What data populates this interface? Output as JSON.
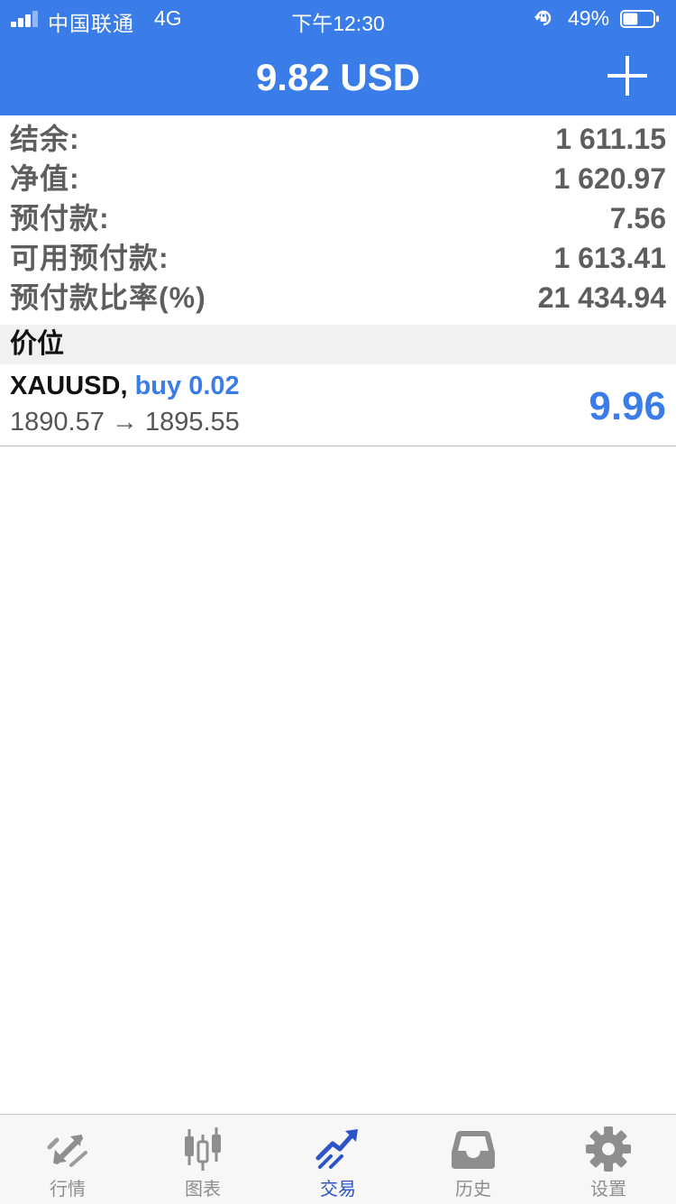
{
  "status_bar": {
    "carrier": "中国联通",
    "network": "4G",
    "time": "下午12:30",
    "battery_percent": "49%",
    "battery_level": 0.49
  },
  "header": {
    "title": "9.82 USD",
    "add_icon": "plus-icon"
  },
  "summary": [
    {
      "label": "结余:",
      "value": "1 611.15"
    },
    {
      "label": "净值:",
      "value": "1 620.97"
    },
    {
      "label": "预付款:",
      "value": "7.56"
    },
    {
      "label": "可用预付款:",
      "value": "1 613.41"
    },
    {
      "label": "预付款比率(%)",
      "value": "21 434.94"
    }
  ],
  "positions": {
    "header": "价位",
    "items": [
      {
        "symbol": "XAUUSD,",
        "side": "buy 0.02",
        "open_price": "1890.57",
        "arrow": "→",
        "current_price": "1895.55",
        "profit": "9.96"
      }
    ]
  },
  "tabbar": {
    "active": "trade",
    "tabs": [
      {
        "id": "quotes",
        "label": "行情",
        "icon": "quotes-arrows-icon"
      },
      {
        "id": "charts",
        "label": "图表",
        "icon": "candlestick-icon"
      },
      {
        "id": "trade",
        "label": "交易",
        "icon": "trade-trend-icon"
      },
      {
        "id": "history",
        "label": "历史",
        "icon": "inbox-tray-icon"
      },
      {
        "id": "settings",
        "label": "设置",
        "icon": "gear-icon"
      }
    ]
  },
  "colors": {
    "header_bg": "#3a7de9",
    "accent_blue": "#3a7de9",
    "active_tab": "#2a54c8",
    "inactive_tab": "#8e8e8e",
    "summary_text": "#5e5e5e"
  }
}
